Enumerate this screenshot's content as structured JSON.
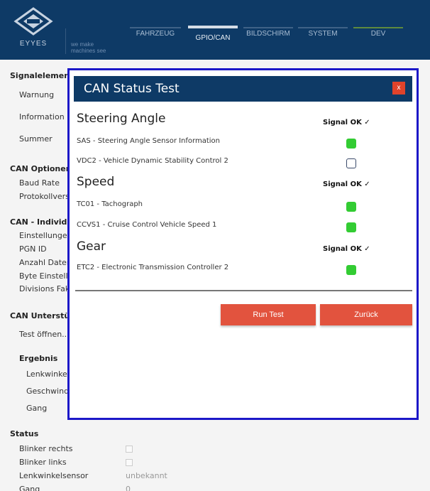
{
  "header": {
    "logo_text": "EYYES",
    "tagline_line1": "we make",
    "tagline_line2": "machines see",
    "tabs": [
      {
        "label": "FAHRZEUG"
      },
      {
        "label": "GPIO/CAN"
      },
      {
        "label": "BILDSCHIRM"
      },
      {
        "label": "SYSTEM"
      },
      {
        "label": "DEV"
      }
    ],
    "active_tab": "GPIO/CAN"
  },
  "background": {
    "signalelement": {
      "heading": "Signalelement",
      "items": [
        "Warnung",
        "Information",
        "Summer"
      ]
    },
    "can_optionen": {
      "heading": "CAN Optionen",
      "items": [
        "Baud Rate",
        "Protokollvers"
      ]
    },
    "can_individual": {
      "heading": "CAN - Individu",
      "items": [
        "Einstellunger",
        "PGN ID",
        "Anzahl Dater",
        "Byte Einstellu",
        "Divisions Fakt"
      ]
    },
    "can_unterstuetzung": {
      "heading": "CAN Unterstütz",
      "test_button": "Test öffnen...",
      "ergebnis": "Ergebnis",
      "items": [
        "Lenkwinkel",
        "Geschwindi",
        "Gang"
      ]
    },
    "status": {
      "heading": "Status",
      "rows": [
        {
          "label": "Blinker rechts",
          "value": ""
        },
        {
          "label": "Blinker links",
          "value": ""
        },
        {
          "label": "Lenkwinkelsensor",
          "value": "unbekannt"
        },
        {
          "label": "Gang",
          "value": "0"
        }
      ]
    }
  },
  "modal": {
    "title": "CAN Status Test",
    "close_label": "x",
    "sections": [
      {
        "title": "Steering Angle",
        "signal_status": "Signal OK ✓",
        "rows": [
          {
            "label": "SAS - Steering Angle Sensor Information",
            "ok": true
          },
          {
            "label": "VDC2 - Vehicle Dynamic Stability Control 2",
            "ok": false
          }
        ]
      },
      {
        "title": "Speed",
        "signal_status": "Signal OK ✓",
        "rows": [
          {
            "label": "TC01 - Tachograph",
            "ok": true
          },
          {
            "label": "CCVS1 - Cruise Control Vehicle Speed 1",
            "ok": true
          }
        ]
      },
      {
        "title": "Gear",
        "signal_status": "Signal OK ✓",
        "rows": [
          {
            "label": "ETC2 - Electronic Transmission Controller 2",
            "ok": true
          }
        ]
      }
    ],
    "run_test_label": "Run Test",
    "back_label": "Zurück"
  },
  "colors": {
    "header_bg": "#0e3a66",
    "modal_border": "#1c18c8",
    "button_bg": "#e2533e",
    "status_ok": "#33cc33"
  }
}
